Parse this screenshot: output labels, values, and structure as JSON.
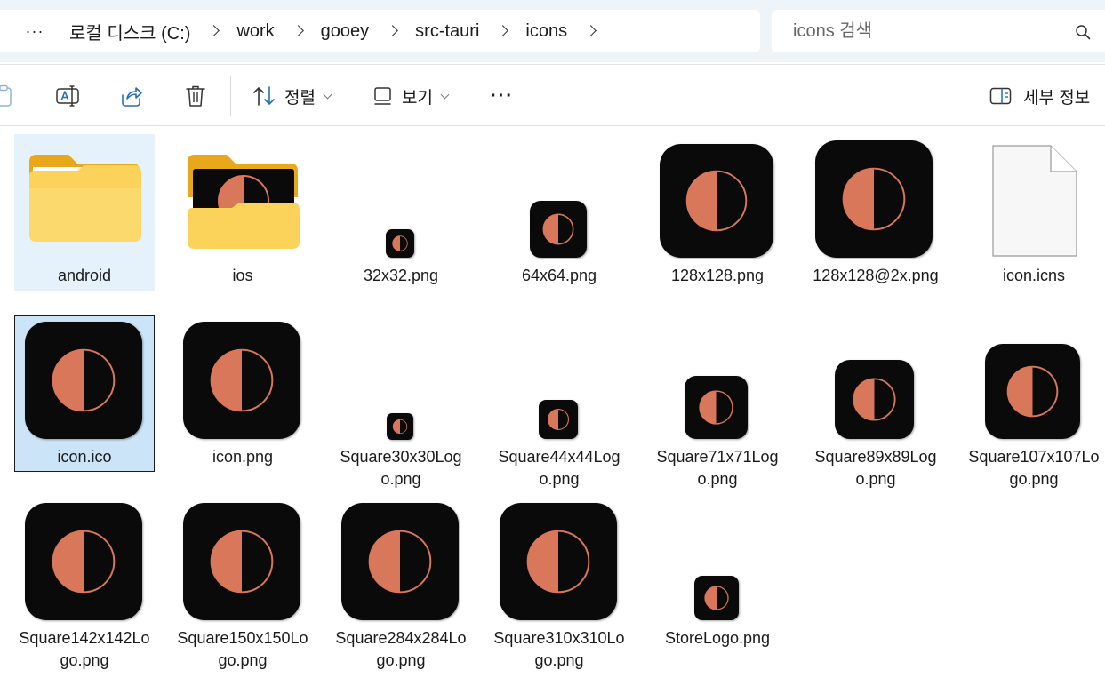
{
  "address": {
    "more_label": "···",
    "crumbs": [
      "로컬 디스크 (C:)",
      "work",
      "gooey",
      "src-tauri",
      "icons"
    ]
  },
  "search": {
    "placeholder": "icons 검색"
  },
  "toolbar": {
    "sort_label": "정렬",
    "view_label": "보기",
    "more_label": "···",
    "details_label": "세부 정보"
  },
  "files": [
    {
      "name": "android",
      "kind": "folder"
    },
    {
      "name": "ios",
      "kind": "folder-preview"
    },
    {
      "name": "32x32.png",
      "kind": "image"
    },
    {
      "name": "64x64.png",
      "kind": "image"
    },
    {
      "name": "128x128.png",
      "kind": "image"
    },
    {
      "name": "128x128@2x.png",
      "kind": "image"
    },
    {
      "name": "icon.icns",
      "kind": "blank-file"
    },
    {
      "name": "icon.ico",
      "kind": "image"
    },
    {
      "name": "icon.png",
      "kind": "image"
    },
    {
      "name": "Square30x30Logo.png",
      "kind": "image"
    },
    {
      "name": "Square44x44Logo.png",
      "kind": "image"
    },
    {
      "name": "Square71x71Logo.png",
      "kind": "image"
    },
    {
      "name": "Square89x89Logo.png",
      "kind": "image"
    },
    {
      "name": "Square107x107Logo.png",
      "kind": "image"
    },
    {
      "name": "Square142x142Logo.png",
      "kind": "image"
    },
    {
      "name": "Square150x150Logo.png",
      "kind": "image"
    },
    {
      "name": "Square284x284Logo.png",
      "kind": "image"
    },
    {
      "name": "Square310x310Logo.png",
      "kind": "image"
    },
    {
      "name": "StoreLogo.png",
      "kind": "image"
    }
  ],
  "colors": {
    "icon_bg": "#0a0a0a",
    "icon_accent": "#d9775a",
    "selection": "#e5f1fb",
    "focus_selection": "#cce4f7",
    "folder": "#f9c43a"
  }
}
